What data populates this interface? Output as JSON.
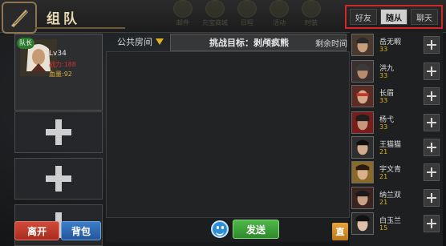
{
  "header": {
    "title": "组队"
  },
  "top_icons": [
    "邮件",
    "元宝商城",
    "日程",
    "活动",
    "时装"
  ],
  "tabs": [
    {
      "label": "好友"
    },
    {
      "label": "随从"
    },
    {
      "label": "聊天"
    }
  ],
  "leader": {
    "badge": "队长",
    "level": "Lv34",
    "stat_power": "战力:188",
    "stat_hp": "血量:92"
  },
  "buttons": {
    "leave": "离开",
    "bag": "背包",
    "send": "发送",
    "direct": "直"
  },
  "room": {
    "type": "公共房间",
    "goal": "挑战目标：剥颅疯熊",
    "remaining": "剩余时间"
  },
  "friends": [
    {
      "name": "岳无暇",
      "level": "33"
    },
    {
      "name": "洪九",
      "level": "33"
    },
    {
      "name": "长眉",
      "level": "33"
    },
    {
      "name": "杨弋",
      "level": "33"
    },
    {
      "name": "王猫猫",
      "level": "21"
    },
    {
      "name": "宇文青",
      "level": "21"
    },
    {
      "name": "纳兰双",
      "level": "21"
    },
    {
      "name": "白玉兰",
      "level": "15"
    }
  ],
  "colors": {
    "tab_highlight": "#d2262b",
    "send": "#3fa63a",
    "leave": "#c23a2c",
    "bag": "#2f6cb8",
    "level": "#e0b020"
  }
}
